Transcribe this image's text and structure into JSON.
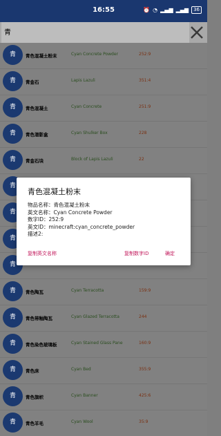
{
  "status_bar": {
    "time": "16:55",
    "icons": [
      "alarm-icon",
      "wifi-icon",
      "signal-4g-icon",
      "signal-4g-icon"
    ],
    "battery": "36"
  },
  "search": {
    "value": "青"
  },
  "list": [
    {
      "avatar": "青",
      "name_cn": "青色混凝土粉末",
      "name_en": "Cyan Concrete Powder",
      "id": "252:9"
    },
    {
      "avatar": "青",
      "name_cn": "青金石",
      "name_en": "Lapis Lazuli",
      "id": "351:4"
    },
    {
      "avatar": "青",
      "name_cn": "青色混凝土",
      "name_en": "Cyan Concrete",
      "id": "251:9"
    },
    {
      "avatar": "青",
      "name_cn": "青色潜影盒",
      "name_en": "Cyan Shulker Box",
      "id": "228"
    },
    {
      "avatar": "青",
      "name_cn": "青金石块",
      "name_en": "Block of Lapis Lazuli",
      "id": "22"
    },
    {
      "avatar": "青",
      "name_cn": "",
      "name_en": "",
      "id": ""
    },
    {
      "avatar": "青",
      "name_cn": "",
      "name_en": "",
      "id": ""
    },
    {
      "avatar": "青",
      "name_cn": "",
      "name_en": "",
      "id": ""
    },
    {
      "avatar": "青",
      "name_cn": "",
      "name_en": "",
      "id": ""
    },
    {
      "avatar": "青",
      "name_cn": "青色陶瓦",
      "name_en": "Cyan Terracotta",
      "id": "159:9"
    },
    {
      "avatar": "青",
      "name_cn": "青色带釉陶瓦",
      "name_en": "Cyan Glazed Terracotta",
      "id": "244"
    },
    {
      "avatar": "青",
      "name_cn": "青色染色玻璃板",
      "name_en": "Cyan Stained Glass Pane",
      "id": "160:9"
    },
    {
      "avatar": "青",
      "name_cn": "青色床",
      "name_en": "Cyan Bed",
      "id": "355:9"
    },
    {
      "avatar": "青",
      "name_cn": "青色旗帜",
      "name_en": "Cyan Banner",
      "id": "425:6"
    },
    {
      "avatar": "青",
      "name_cn": "青色羊毛",
      "name_en": "Cyan Wool",
      "id": "35:9"
    }
  ],
  "dialog": {
    "title": "青色混凝土粉末",
    "line1": "物品名称：青色混凝土粉末",
    "line2": "英文名称：Cyan Concrete Powder",
    "line3": "数字ID：252:9",
    "line4": "英文ID：minecraft:cyan_concrete_powder",
    "line5": "描述2:",
    "copy_en": "复制英文名称",
    "copy_id": "复制数字ID",
    "confirm": "确定"
  }
}
